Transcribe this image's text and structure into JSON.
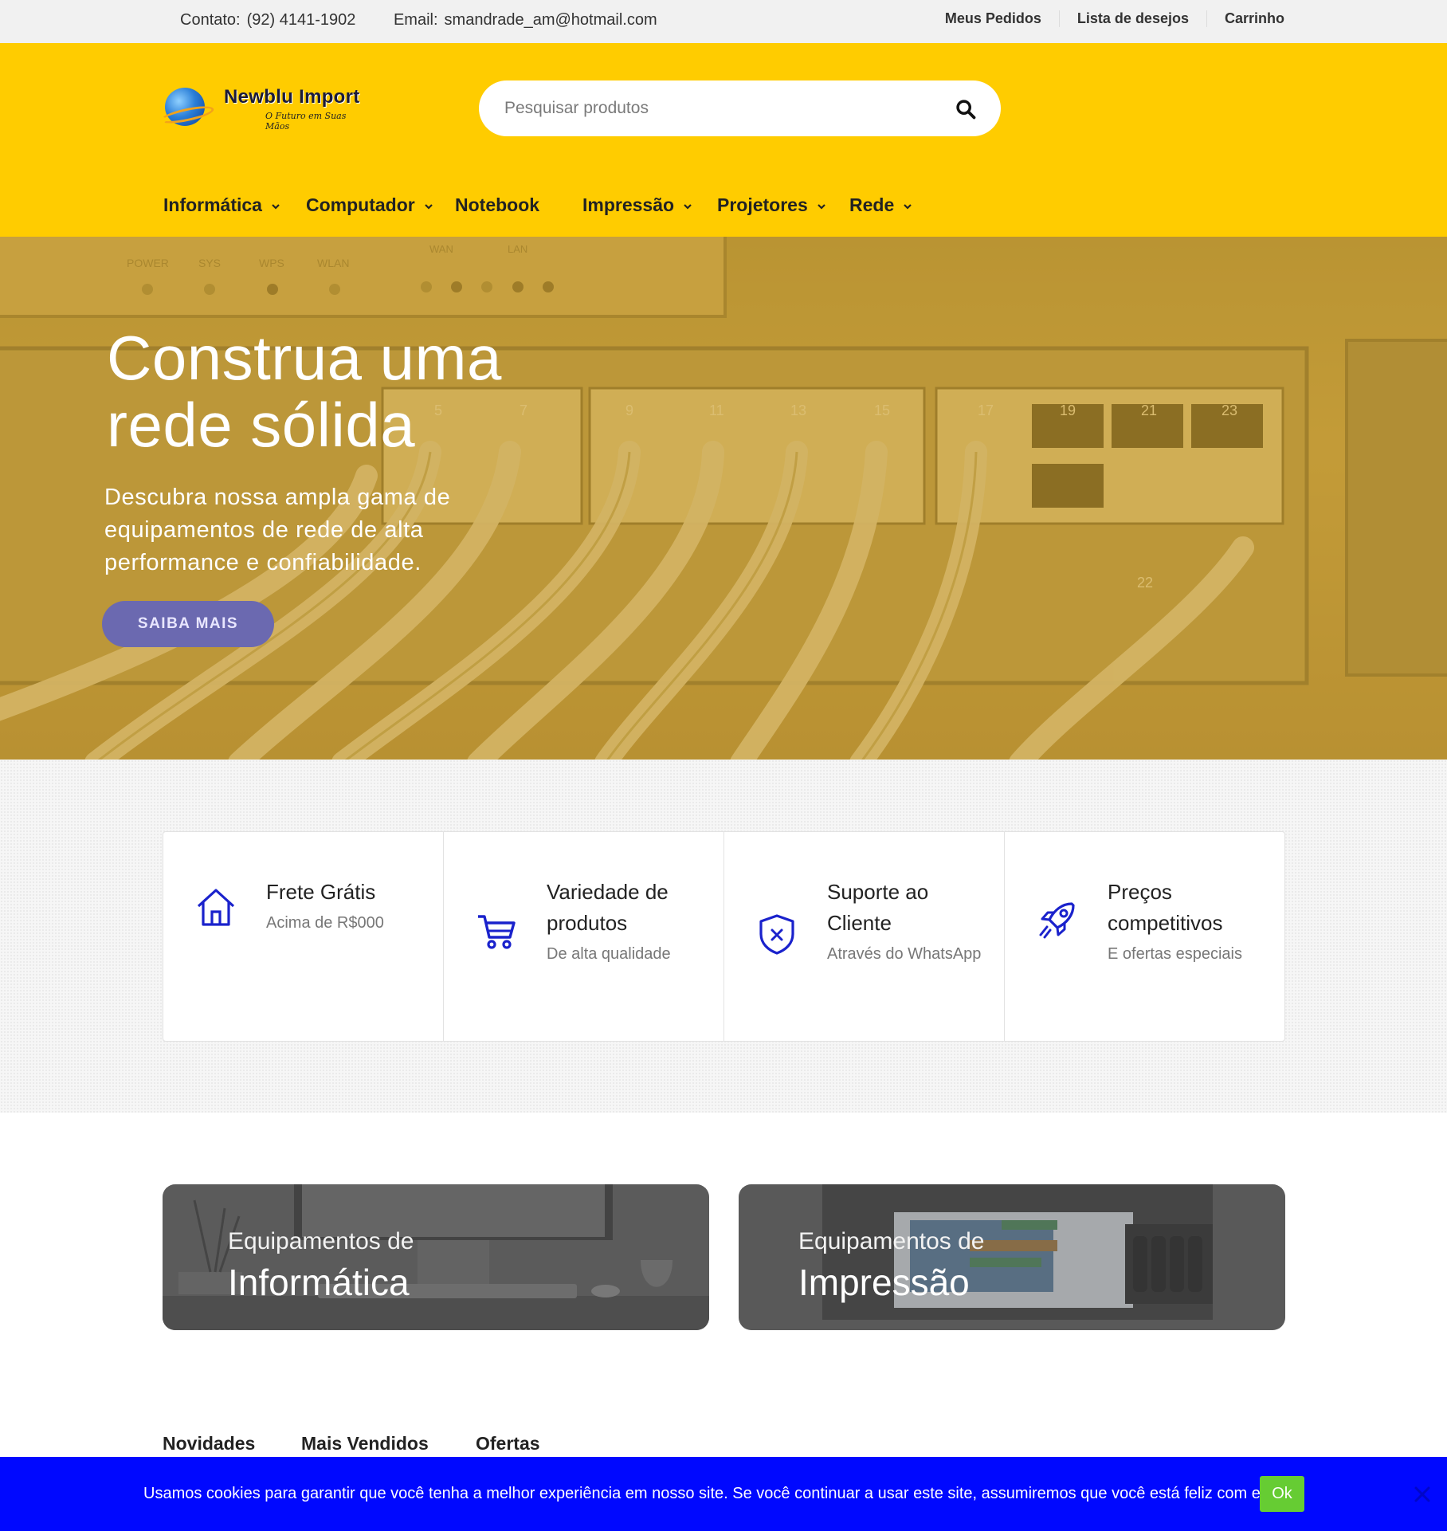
{
  "topbar": {
    "contact_label": "Contato:",
    "contact_value": "(92) 4141-1902",
    "email_label": "Email:",
    "email_value": "smandrade_am@hotmail.com",
    "links": [
      "Meus Pedidos",
      "Lista de desejos",
      "Carrinho"
    ]
  },
  "header": {
    "logo_name": "Newblu Import",
    "logo_tagline": "O Futuro em Suas Mãos",
    "search_placeholder": "Pesquisar produtos",
    "nav": [
      {
        "label": "Informática",
        "dropdown": true
      },
      {
        "label": "Computador",
        "dropdown": true
      },
      {
        "label": "Notebook",
        "dropdown": false
      },
      {
        "label": "Impressão",
        "dropdown": true
      },
      {
        "label": "Projetores",
        "dropdown": true
      },
      {
        "label": "Rede",
        "dropdown": true
      }
    ]
  },
  "hero": {
    "title_line1": "Construa uma",
    "title_line2": "rede sólida",
    "subtitle": "Descubra nossa ampla gama de equipamentos de rede de alta performance e confiabilidade.",
    "button": "SAIBA MAIS",
    "device_labels": [
      "POWER",
      "SYS",
      "WPS",
      "WLAN",
      "WAN",
      "LAN"
    ],
    "port_numbers": [
      "5",
      "7",
      "9",
      "11",
      "13",
      "15",
      "17",
      "19",
      "21",
      "23",
      "22"
    ]
  },
  "features": [
    {
      "icon": "home-icon",
      "title": "Frete Grátis",
      "desc": "Acima de R$000"
    },
    {
      "icon": "cart-icon",
      "title": "Variedade de produtos",
      "desc": "De alta qualidade"
    },
    {
      "icon": "shield-icon",
      "title": "Suporte ao Cliente",
      "desc": "Através do WhatsApp"
    },
    {
      "icon": "rocket-icon",
      "title": "Preços competitivos",
      "desc": "E ofertas especiais"
    }
  ],
  "categories": [
    {
      "pre": "Equipamentos de",
      "main": "Informática"
    },
    {
      "pre": "Equipamentos de",
      "main": "Impressão"
    }
  ],
  "tabs": [
    "Novidades",
    "Mais Vendidos",
    "Ofertas"
  ],
  "cookie": {
    "message": "Usamos cookies para garantir que você tenha a melhor experiência em nosso site. Se você continuar a usar este site, assumiremos que você está feliz com ele.",
    "ok": "Ok"
  },
  "colors": {
    "header_yellow": "#ffcc00",
    "hero_overlay": "#c49c38",
    "accent_blue": "#1a22cc",
    "hero_button": "#6b69b0",
    "cookie_bar": "#0008ff",
    "cookie_ok": "#66cc33"
  }
}
